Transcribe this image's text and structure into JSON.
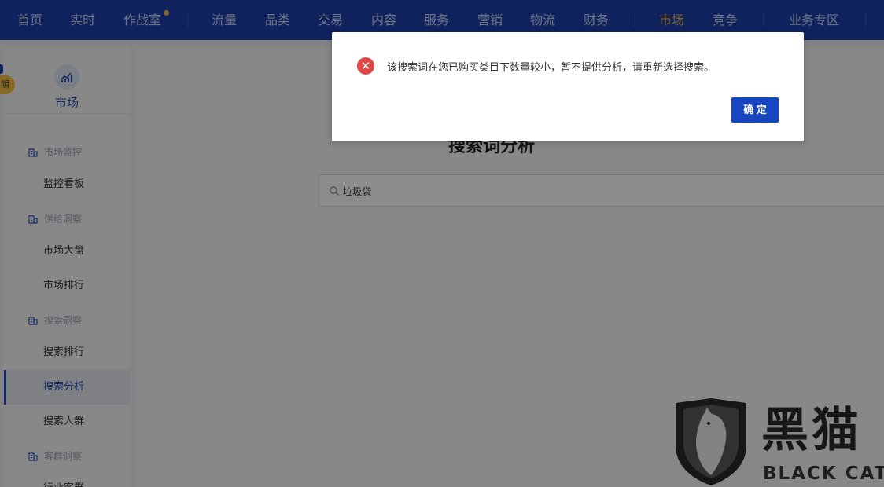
{
  "nav": {
    "items": [
      {
        "label": "首页"
      },
      {
        "label": "实时"
      },
      {
        "label": "作战室"
      },
      {
        "label": "流量"
      },
      {
        "label": "品类"
      },
      {
        "label": "交易"
      },
      {
        "label": "内容"
      },
      {
        "label": "服务"
      },
      {
        "label": "营销"
      },
      {
        "label": "物流"
      },
      {
        "label": "财务"
      },
      {
        "label": "市场"
      },
      {
        "label": "竞争"
      },
      {
        "label": "业务专区"
      }
    ],
    "active": "市场",
    "colors": {
      "bar": "#1c3faa",
      "active": "#e4b44a"
    }
  },
  "left_tab": {
    "label": "明"
  },
  "sidebar": {
    "title": "市场",
    "groups": [
      {
        "label": "市场监控"
      },
      {
        "label": "供给洞察"
      },
      {
        "label": "搜索洞察"
      },
      {
        "label": "客群洞察"
      }
    ],
    "items": [
      {
        "label": "监控看板"
      },
      {
        "label": "市场大盘"
      },
      {
        "label": "市场排行"
      },
      {
        "label": "搜索排行"
      },
      {
        "label": "搜索分析"
      },
      {
        "label": "搜索人群"
      },
      {
        "label": "行业客群"
      }
    ],
    "active": "搜索分析"
  },
  "main": {
    "page_title": "搜索词分析",
    "search_value": "垃圾袋"
  },
  "dialog": {
    "message": "该搜索词在您已购买类目下数量较小，暂不提供分析，请重新选择搜索。",
    "ok_label": "确 定",
    "icon": "error-icon",
    "colors": {
      "error": "#e04646",
      "button": "#1846c0"
    }
  },
  "watermark": {
    "cn": "黑猫",
    "en": "BLACK CAT"
  }
}
